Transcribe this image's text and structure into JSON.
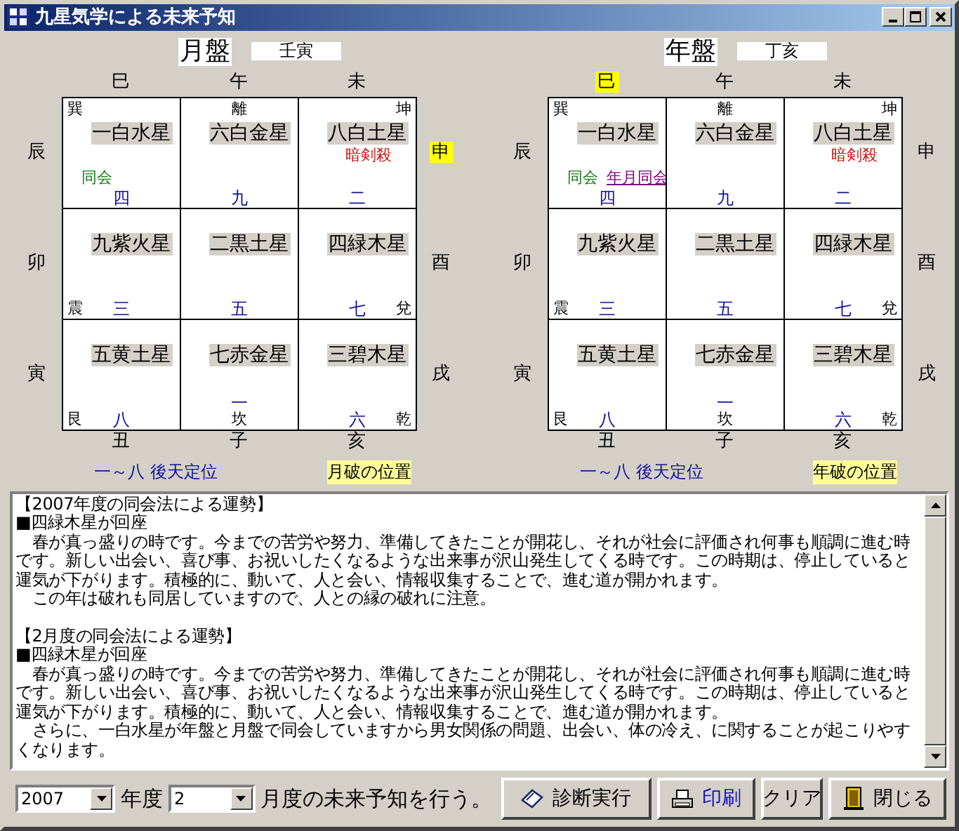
{
  "window": {
    "title": "九星気学による未来予知"
  },
  "boards": [
    {
      "title": "月盤",
      "kanshi": "壬寅",
      "top": [
        {
          "label": "巳",
          "highlighted": false
        },
        {
          "label": "午",
          "highlighted": false
        },
        {
          "label": "未",
          "highlighted": false
        }
      ],
      "left": [
        {
          "label": "辰",
          "highlighted": false
        },
        {
          "label": "卯",
          "highlighted": false
        },
        {
          "label": "寅",
          "highlighted": false
        }
      ],
      "right": [
        {
          "label": "申",
          "highlighted": true
        },
        {
          "label": "酉",
          "highlighted": false
        },
        {
          "label": "戌",
          "highlighted": false
        }
      ],
      "bottom": [
        {
          "label": "丑",
          "highlighted": false
        },
        {
          "label": "子",
          "highlighted": false
        },
        {
          "label": "亥",
          "highlighted": false
        }
      ],
      "cells": [
        {
          "star": "一白水星",
          "number": "四",
          "trigram": "巽",
          "notes": [
            {
              "text": "同会",
              "kind": "doukai"
            }
          ]
        },
        {
          "star": "六白金星",
          "number": "九",
          "trigram": "離"
        },
        {
          "star": "八白土星",
          "number": "二",
          "trigram": "坤",
          "notes": [
            {
              "text": "暗剣殺",
              "kind": "ankensatsu"
            }
          ]
        },
        {
          "star": "九紫火星",
          "number": "三",
          "trigram": "震"
        },
        {
          "star": "二黒土星",
          "number": "五"
        },
        {
          "star": "四緑木星",
          "number": "七",
          "trigram": "兌"
        },
        {
          "star": "五黄土星",
          "number": "八",
          "trigram": "艮"
        },
        {
          "star": "七赤金星",
          "number": "一",
          "trigram": "坎"
        },
        {
          "star": "三碧木星",
          "number": "六",
          "trigram": "乾"
        }
      ],
      "legend": [
        {
          "text": "一～八 後天定位",
          "kind": "plain"
        },
        {
          "text": "月破の位置",
          "kind": "marker"
        }
      ]
    },
    {
      "title": "年盤",
      "kanshi": "丁亥",
      "top": [
        {
          "label": "巳",
          "highlighted": true
        },
        {
          "label": "午",
          "highlighted": false
        },
        {
          "label": "未",
          "highlighted": false
        }
      ],
      "left": [
        {
          "label": "辰",
          "highlighted": false
        },
        {
          "label": "卯",
          "highlighted": false
        },
        {
          "label": "寅",
          "highlighted": false
        }
      ],
      "right": [
        {
          "label": "申",
          "highlighted": false
        },
        {
          "label": "酉",
          "highlighted": false
        },
        {
          "label": "戌",
          "highlighted": false
        }
      ],
      "bottom": [
        {
          "label": "丑",
          "highlighted": false
        },
        {
          "label": "子",
          "highlighted": false
        },
        {
          "label": "亥",
          "highlighted": false
        }
      ],
      "cells": [
        {
          "star": "一白水星",
          "number": "四",
          "trigram": "巽",
          "notes": [
            {
              "text": "同会",
              "kind": "doukai"
            },
            {
              "text": "年月同会",
              "kind": "nengetsu"
            }
          ]
        },
        {
          "star": "六白金星",
          "number": "九",
          "trigram": "離"
        },
        {
          "star": "八白土星",
          "number": "二",
          "trigram": "坤",
          "notes": [
            {
              "text": "暗剣殺",
              "kind": "ankensatsu"
            }
          ]
        },
        {
          "star": "九紫火星",
          "number": "三",
          "trigram": "震"
        },
        {
          "star": "二黒土星",
          "number": "五"
        },
        {
          "star": "四緑木星",
          "number": "七",
          "trigram": "兌"
        },
        {
          "star": "五黄土星",
          "number": "八",
          "trigram": "艮"
        },
        {
          "star": "七赤金星",
          "number": "一",
          "trigram": "坎"
        },
        {
          "star": "三碧木星",
          "number": "六",
          "trigram": "乾"
        }
      ],
      "legend": [
        {
          "text": "一～八 後天定位",
          "kind": "plain"
        },
        {
          "text": "年破の位置",
          "kind": "marker"
        }
      ]
    }
  ],
  "report": {
    "sections": [
      {
        "heading": "【2007年度の同会法による運勢】",
        "lines": [
          "■四緑木星が回座",
          "　春が真っ盛りの時です。今までの苦労や努力、準備してきたことが開花し、それが社会に評価され何事も順調に進む時です。新しい出会い、喜び事、お祝いしたくなるような出来事が沢山発生してくる時です。この時期は、停止していると運気が下がります。積極的に、動いて、人と会い、情報収集することで、進む道が開かれます。",
          "　この年は破れも同居していますので、人との縁の破れに注意。"
        ]
      },
      {
        "heading": "【2月度の同会法による運勢】",
        "lines": [
          "■四緑木星が回座",
          "　春が真っ盛りの時です。今までの苦労や努力、準備してきたことが開花し、それが社会に評価され何事も順調に進む時です。新しい出会い、喜び事、お祝いしたくなるような出来事が沢山発生してくる時です。この時期は、停止していると運気が下がります。積極的に、動いて、人と会い、情報収集することで、進む道が開かれます。",
          "　さらに、一白水星が年盤と月盤で同会していますから男女関係の問題、出会い、体の冷え、に関することが起こりやすくなります。"
        ]
      }
    ]
  },
  "controls": {
    "year": "2007",
    "year_label": "年度",
    "month": "2",
    "month_label": "月度の未来予知を行う。",
    "buttons": [
      "診断実行",
      "印刷",
      "クリア",
      "閉じる"
    ]
  }
}
